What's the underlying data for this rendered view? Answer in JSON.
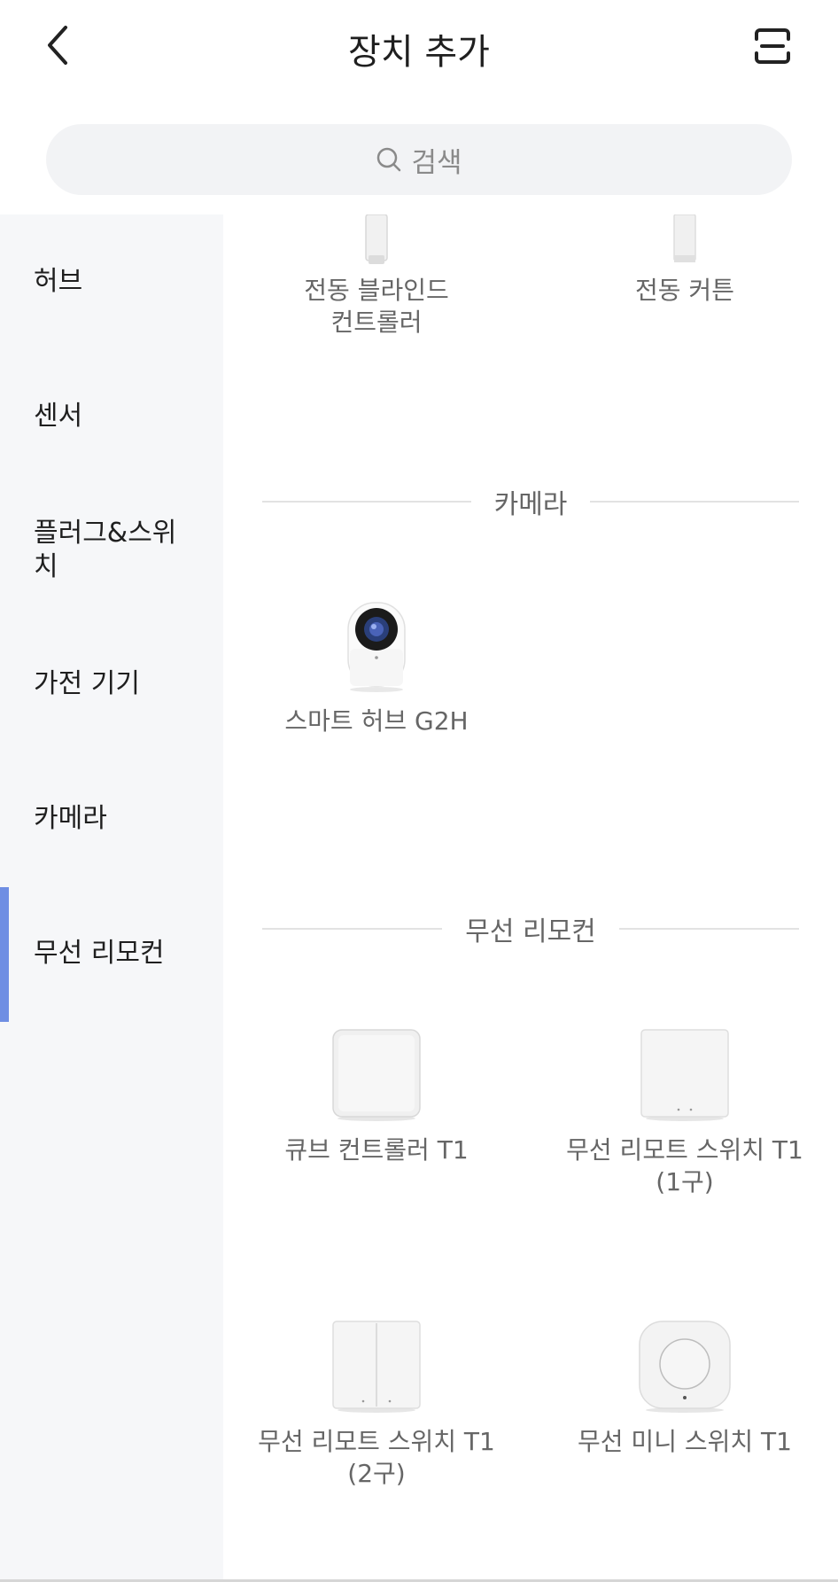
{
  "header": {
    "title": "장치 추가",
    "back_icon": "chevron-left-icon",
    "scan_icon": "scan-icon"
  },
  "search": {
    "placeholder": "검색",
    "icon": "search-icon"
  },
  "sidebar": {
    "items": [
      {
        "label": "허브"
      },
      {
        "label": "센서"
      },
      {
        "label": "플러그&스위\n치"
      },
      {
        "label": "가전 기기"
      },
      {
        "label": "카메라"
      },
      {
        "label": "무선 리모컨"
      }
    ],
    "active_index": 5,
    "active_color": "#6f8ee3"
  },
  "content": {
    "top_products": [
      {
        "label": "전동 블라인드\n컨트롤러"
      },
      {
        "label": "전동 커튼"
      }
    ],
    "sections": [
      {
        "title": "카메라",
        "products": [
          {
            "label": "스마트 허브 G2H"
          }
        ]
      },
      {
        "title": "무선 리모컨",
        "products": [
          {
            "label": "큐브 컨트롤러 T1"
          },
          {
            "label": "무선 리모트 스위치 T1\n(1구)"
          },
          {
            "label": "무선 리모트 스위치 T1\n(2구)"
          },
          {
            "label": "무선 미니 스위치 T1"
          }
        ]
      }
    ]
  }
}
